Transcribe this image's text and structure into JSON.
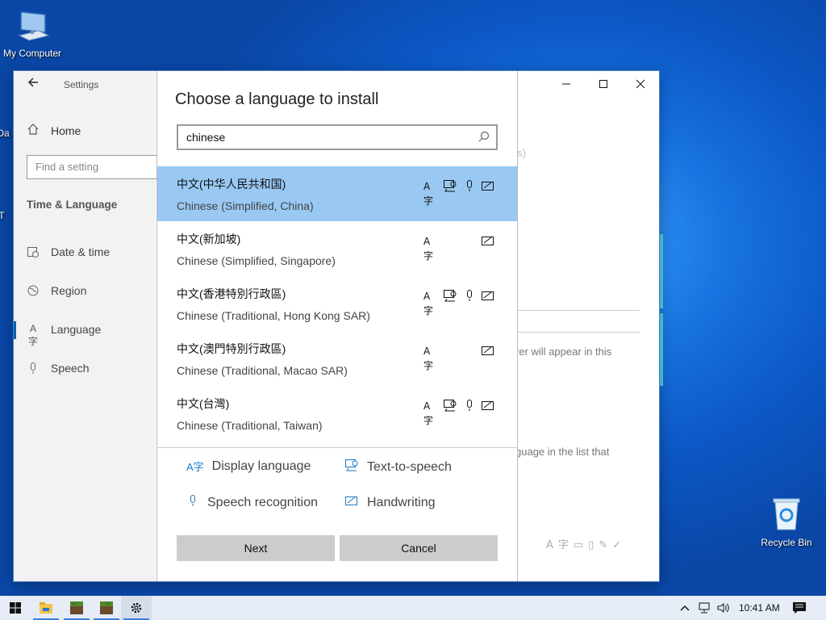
{
  "desktop": {
    "icons": [
      {
        "label": "My Computer"
      },
      {
        "label": "Recycle Bin"
      }
    ],
    "partial_labels": [
      "Da",
      "T"
    ]
  },
  "settings_window": {
    "title": "Settings",
    "home_label": "Home",
    "search_placeholder": "Find a setting",
    "section_title": "Time & Language",
    "nav_items": [
      {
        "label": "Date & time",
        "icon": "clock-calendar-icon"
      },
      {
        "label": "Region",
        "icon": "globe-icon"
      },
      {
        "label": "Language",
        "icon": "language-icon",
        "selected": true
      },
      {
        "label": "Speech",
        "icon": "microphone-icon"
      }
    ],
    "background_texts": [
      "s)",
      "rer will appear in this",
      "guage in the list that"
    ]
  },
  "dialog": {
    "title": "Choose a language to install",
    "search_value": "chinese",
    "languages": [
      {
        "native": "中文(中华人民共和国)",
        "english": "Chinese (Simplified, China)",
        "selected": true,
        "features": {
          "display": true,
          "tts": true,
          "speech": true,
          "handwriting": true
        }
      },
      {
        "native": "中文(新加坡)",
        "english": "Chinese (Simplified, Singapore)",
        "selected": false,
        "features": {
          "display": true,
          "tts": false,
          "speech": false,
          "handwriting": true
        }
      },
      {
        "native": "中文(香港特別行政區)",
        "english": "Chinese (Traditional, Hong Kong SAR)",
        "selected": false,
        "features": {
          "display": true,
          "tts": true,
          "speech": true,
          "handwriting": true
        }
      },
      {
        "native": "中文(澳門特別行政區)",
        "english": "Chinese (Traditional, Macao SAR)",
        "selected": false,
        "features": {
          "display": true,
          "tts": false,
          "speech": false,
          "handwriting": true
        }
      },
      {
        "native": "中文(台灣)",
        "english": "Chinese (Traditional, Taiwan)",
        "selected": false,
        "features": {
          "display": true,
          "tts": true,
          "speech": true,
          "handwriting": true
        }
      }
    ],
    "legend": {
      "display": "Display language",
      "tts": "Text-to-speech",
      "speech": "Speech recognition",
      "handwriting": "Handwriting"
    },
    "buttons": {
      "next": "Next",
      "cancel": "Cancel"
    }
  },
  "taskbar": {
    "apps": [
      "start-icon",
      "file-explorer-icon",
      "minecraft-icon",
      "minecraft-icon",
      "settings-gear-icon"
    ],
    "time": "10:41 AM"
  },
  "colors": {
    "selection": "#99c9f3",
    "accent": "#0063b1",
    "button_bg": "#cccccc"
  }
}
